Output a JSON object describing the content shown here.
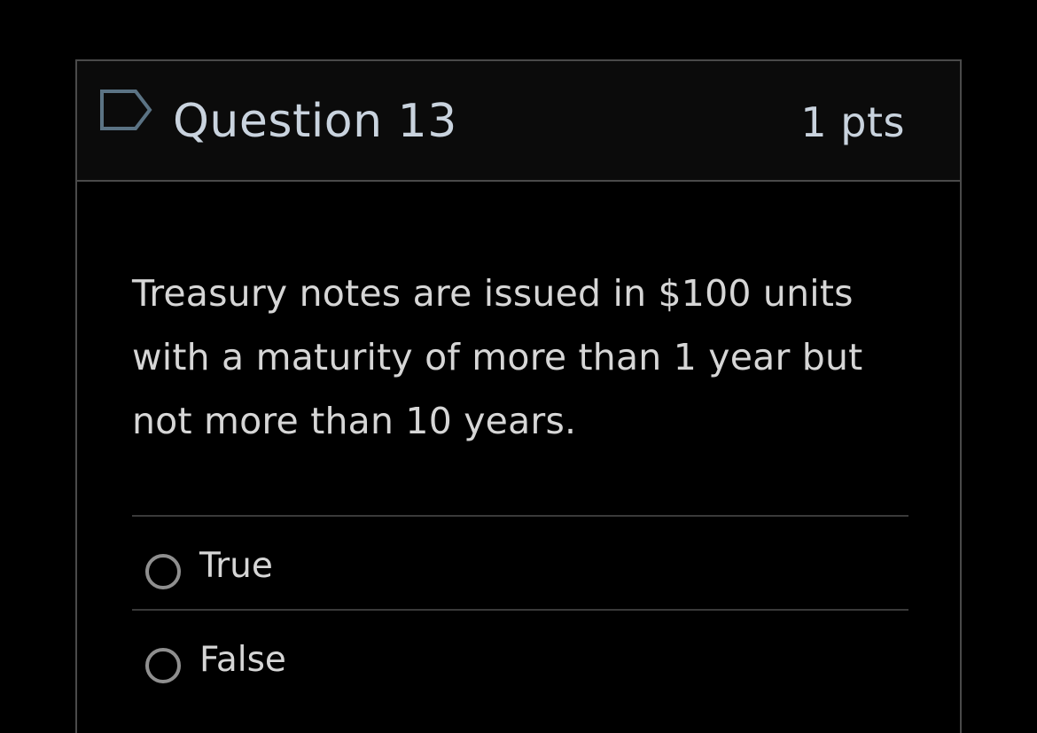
{
  "question": {
    "title": "Question 13",
    "points": "1 pts",
    "flag_icon": "flag-icon",
    "text": "Treasury notes are issued in $100 units with a maturity of more than 1 year but not more than 10 years."
  },
  "answers": [
    {
      "label": "True",
      "selected": false
    },
    {
      "label": "False",
      "selected": false
    }
  ],
  "colors": {
    "background": "#000000",
    "header_background": "#0b0b0b",
    "border": "#4a4a4a",
    "title_text": "#c9d3de",
    "body_text": "#d6d6d6",
    "flag_stroke": "#5b7384"
  }
}
